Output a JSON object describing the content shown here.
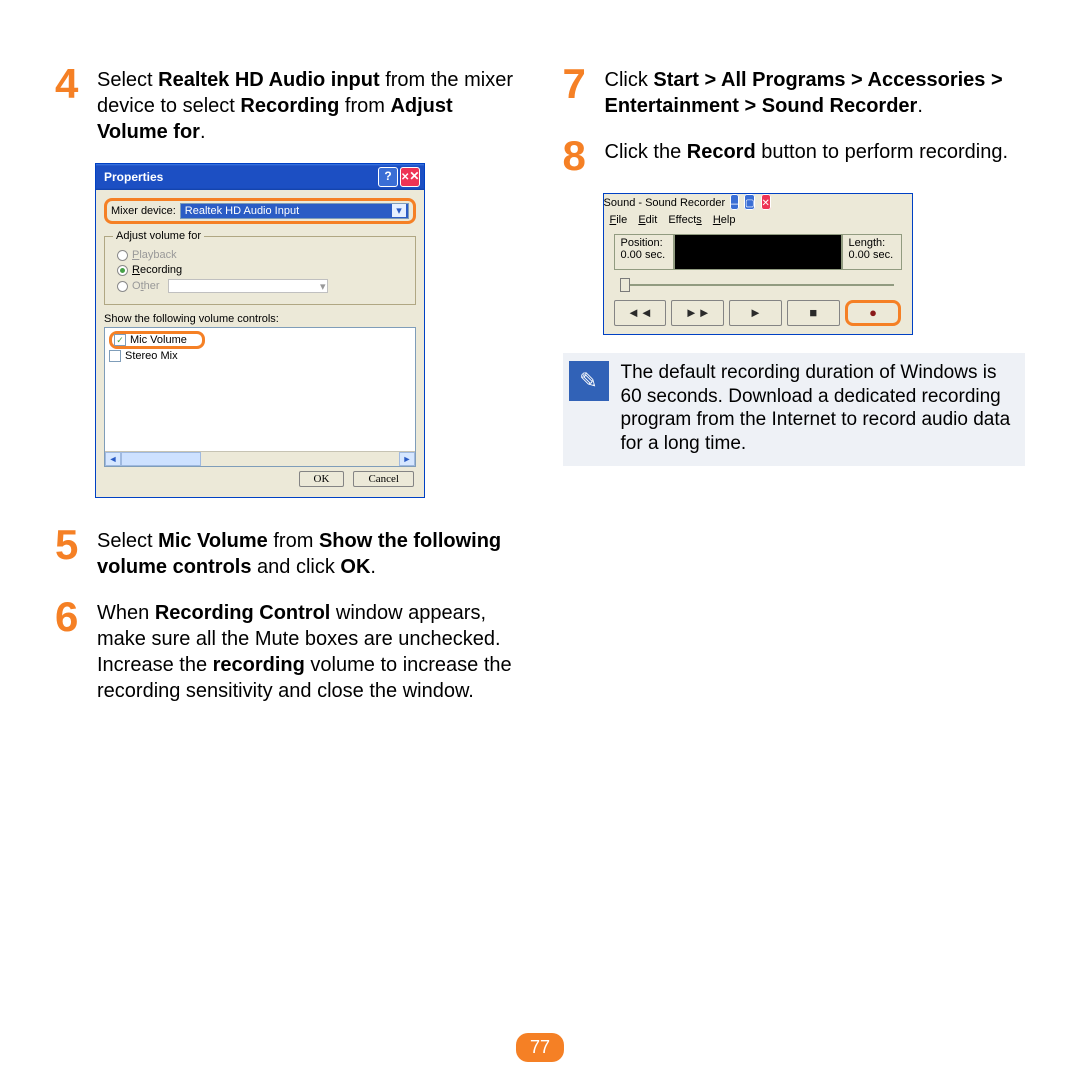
{
  "page_number": "77",
  "left": {
    "step4": {
      "num": "4",
      "text_parts": [
        "Select ",
        "Realtek HD Audio input",
        " from the mixer device to select ",
        "Recording",
        " from ",
        "Adjust Volume for",
        "."
      ]
    },
    "step5": {
      "num": "5",
      "text_parts": [
        "Select ",
        "Mic Volume",
        " from ",
        "Show the following volume controls",
        " and click ",
        "OK",
        "."
      ]
    },
    "step6": {
      "num": "6",
      "text_parts": [
        "When ",
        "Recording Control",
        " window appears, make sure all the Mute boxes are unchecked. Increase the ",
        "recording",
        " volume to increase the recording sensitivity and close the window."
      ]
    }
  },
  "right": {
    "step7": {
      "num": "7",
      "text_parts": [
        "Click ",
        "Start > All Programs > Accessories > Entertainment > Sound Recorder",
        "."
      ]
    },
    "step8": {
      "num": "8",
      "text_parts": [
        "Click the ",
        "Record",
        " button to perform recording."
      ]
    },
    "note": "The default recording duration of Windows is 60 seconds. Download a dedicated recording program from the Internet to record audio data for a long time."
  },
  "properties_dialog": {
    "title": "Properties",
    "mixer_label": "Mixer device:",
    "mixer_value": "Realtek HD Audio Input",
    "adjust_legend": "Adjust volume for",
    "opt_playback": "Playback",
    "opt_recording": "Recording",
    "opt_other": "Other",
    "show_label": "Show the following volume controls:",
    "mic_volume": "Mic Volume",
    "stereo_mix": "Stereo Mix",
    "ok": "OK",
    "cancel": "Cancel"
  },
  "recorder": {
    "title": "Sound - Sound Recorder",
    "menu_file": "File",
    "menu_edit": "Edit",
    "menu_effects": "Effects",
    "menu_help": "Help",
    "position_label": "Position:",
    "position_value": "0.00 sec.",
    "length_label": "Length:",
    "length_value": "0.00 sec."
  }
}
